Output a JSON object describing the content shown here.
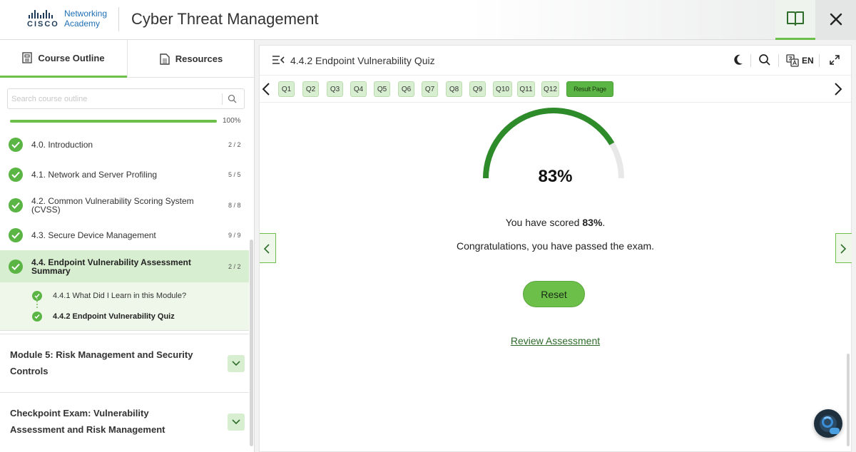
{
  "header": {
    "brand_top": "Networking",
    "brand_bottom": "Academy",
    "brand_cisco": "CISCO",
    "app_title": "Cyber Threat Management",
    "book_icon": "book-open-icon",
    "close_icon": "close-icon"
  },
  "sidebar": {
    "tabs": [
      {
        "label": "Course Outline",
        "icon": "outline-icon",
        "active": true
      },
      {
        "label": "Resources",
        "icon": "document-icon",
        "active": false
      }
    ],
    "search": {
      "placeholder": "Search course outline",
      "value": ""
    },
    "progress": {
      "value": 1.0,
      "text": "100%"
    },
    "items": [
      {
        "label": "4.0. Introduction",
        "count": "2 / 2",
        "completed": true
      },
      {
        "label": "4.1. Network and Server Profiling",
        "count": "5 / 5",
        "completed": true
      },
      {
        "label": "4.2. Common Vulnerability Scoring System (CVSS)",
        "count": "8 / 8",
        "completed": true
      },
      {
        "label": "4.3. Secure Device Management",
        "count": "9 / 9",
        "completed": true
      },
      {
        "label": "4.4. Endpoint Vulnerability Assessment Summary",
        "count": "2 / 2",
        "completed": true,
        "active": true
      }
    ],
    "subitems": [
      {
        "label": "4.4.1 What Did I Learn in this Module?",
        "completed": true
      },
      {
        "label": "4.4.2 Endpoint Vulnerability Quiz",
        "completed": true,
        "current": true
      }
    ],
    "modules": [
      {
        "title": "Module 5: Risk Management and Security Controls"
      },
      {
        "title": "Checkpoint Exam: Vulnerability Assessment and Risk Management"
      }
    ]
  },
  "main": {
    "title": "4.4.2 Endpoint Vulnerability Quiz",
    "language": "EN",
    "toolbar_icons": [
      "dark-mode-icon",
      "search-icon",
      "translate-icon",
      "expand-icon"
    ],
    "questions": [
      "Q1",
      "Q2",
      "Q3",
      "Q4",
      "Q5",
      "Q6",
      "Q7",
      "Q8",
      "Q9",
      "Q10",
      "Q11",
      "Q12"
    ],
    "result_page_label": "Result Page",
    "score": {
      "value": 0.83,
      "percent_text": "83%"
    },
    "scored_prefix": "You have scored ",
    "scored_value": "83%",
    "scored_suffix": ".",
    "congrats": "Congratulations, you have passed the exam.",
    "reset_label": "Reset",
    "review_label": "Review Assessment"
  },
  "colors": {
    "accent_green": "#6cc04a",
    "dark_green": "#2e8b2a",
    "light_green": "#d8eed1",
    "cisco_blue": "#1f6fb4"
  }
}
